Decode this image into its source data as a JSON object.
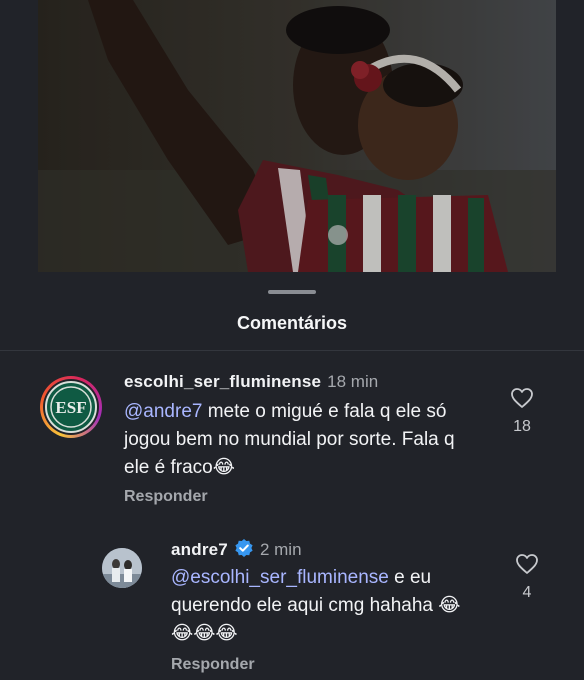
{
  "sheet": {
    "title": "Comentários"
  },
  "comments": [
    {
      "username": "escolhi_ser_fluminense",
      "time": "18 min",
      "mention": "@andre7",
      "text": " mete o migué e fala q ele só jogou bem no mundial por sorte.  Fala q ele é fraco😂",
      "reply_label": "Responder",
      "likes": "18",
      "avatar_icon": "esf-logo-avatar"
    },
    {
      "username": "andre7",
      "verified": true,
      "time": "2 min",
      "mention": "@escolhi_ser_fluminense",
      "text": " e eu querendo ele aqui cmg hahaha 😂😂😂😂",
      "reply_label": "Responder",
      "likes": "4",
      "avatar_icon": "user-photo-avatar"
    }
  ],
  "colors": {
    "background": "#212329",
    "mention": "#a9b6ff",
    "verified": "#3797f0",
    "muted": "#a5a8ad"
  }
}
